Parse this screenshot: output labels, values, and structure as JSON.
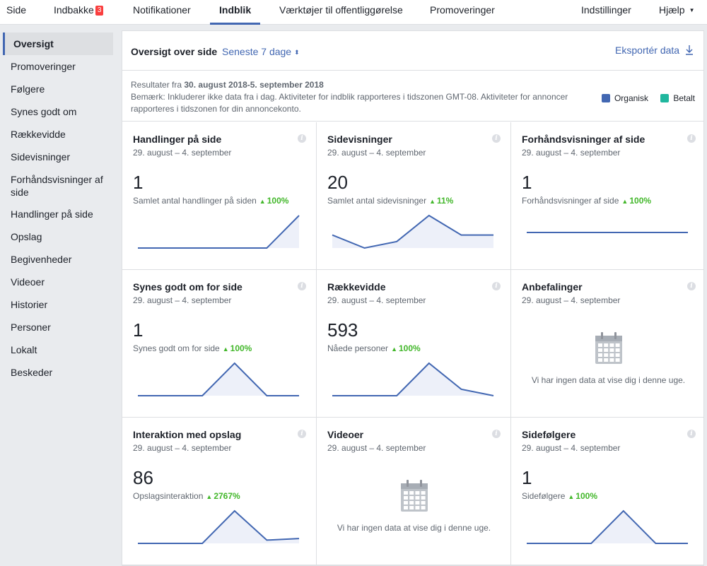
{
  "topnav": {
    "items": [
      {
        "label": "Side"
      },
      {
        "label": "Indbakke",
        "badge": "3"
      },
      {
        "label": "Notifikationer"
      },
      {
        "label": "Indblik"
      },
      {
        "label": "Værktøjer til offentliggørelse"
      },
      {
        "label": "Promoveringer"
      }
    ],
    "right": [
      {
        "label": "Indstillinger"
      },
      {
        "label": "Hjælp"
      }
    ]
  },
  "sidebar": {
    "items": [
      {
        "label": "Oversigt"
      },
      {
        "label": "Promoveringer"
      },
      {
        "label": "Følgere"
      },
      {
        "label": "Synes godt om"
      },
      {
        "label": "Rækkevidde"
      },
      {
        "label": "Sidevisninger"
      },
      {
        "label": "Forhåndsvisninger af side"
      },
      {
        "label": "Handlinger på side"
      },
      {
        "label": "Opslag"
      },
      {
        "label": "Begivenheder"
      },
      {
        "label": "Videoer"
      },
      {
        "label": "Historier"
      },
      {
        "label": "Personer"
      },
      {
        "label": "Lokalt"
      },
      {
        "label": "Beskeder"
      }
    ]
  },
  "header": {
    "title": "Oversigt over side",
    "period": "Seneste 7 dage",
    "export": "Eksportér data"
  },
  "subhead": {
    "results_prefix": "Resultater fra",
    "results_range": "30. august 2018-5. september 2018",
    "note": "Bemærk: Inkluderer ikke data fra i dag. Aktiviteter for indblik rapporteres i tidszonen GMT-08. Aktiviteter for annoncer rapporteres i tidszonen for din annoncekonto.",
    "legend": [
      {
        "label": "Organisk",
        "color": "#4267b2"
      },
      {
        "label": "Betalt",
        "color": "#20b79e"
      }
    ]
  },
  "colors": {
    "line": "#4267b2",
    "fill": "#edf0f9",
    "positive": "#42b72a"
  },
  "cards": [
    {
      "title": "Handlinger på side",
      "range": "29. august – 4. september",
      "value": "1",
      "metric": "Samlet antal handlinger på siden",
      "delta": "100%",
      "spark": [
        0,
        0,
        0,
        0,
        0,
        1
      ]
    },
    {
      "title": "Sidevisninger",
      "range": "29. august – 4. september",
      "value": "20",
      "metric": "Samlet antal sidevisninger",
      "delta": "11%",
      "spark": [
        2,
        0,
        1,
        5,
        2,
        2
      ]
    },
    {
      "title": "Forhåndsvisninger af side",
      "range": "29. august – 4. september",
      "value": "1",
      "metric": "Forhåndsvisninger af side",
      "delta": "100%",
      "spark": [
        1,
        1,
        1,
        1,
        1,
        1
      ]
    },
    {
      "title": "Synes godt om for side",
      "range": "29. august – 4. september",
      "value": "1",
      "metric": "Synes godt om for side",
      "delta": "100%",
      "spark": [
        0,
        0,
        0,
        1,
        0,
        0
      ]
    },
    {
      "title": "Rækkevidde",
      "range": "29. august – 4. september",
      "value": "593",
      "metric": "Nåede personer",
      "delta": "100%",
      "spark": [
        0,
        0,
        0,
        1,
        0.2,
        0
      ]
    },
    {
      "title": "Anbefalinger",
      "range": "29. august – 4. september",
      "nodata": "Vi har ingen data at vise dig i denne uge."
    },
    {
      "title": "Interaktion med opslag",
      "range": "29. august – 4. september",
      "value": "86",
      "metric": "Opslagsinteraktion",
      "delta": "2767%",
      "spark": [
        0,
        0,
        0,
        1,
        0.1,
        0.15
      ]
    },
    {
      "title": "Videoer",
      "range": "29. august – 4. september",
      "nodata": "Vi har ingen data at vise dig i denne uge."
    },
    {
      "title": "Sidefølgere",
      "range": "29. august – 4. september",
      "value": "1",
      "metric": "Sidefølgere",
      "delta": "100%",
      "spark": [
        0,
        0,
        0,
        1,
        0,
        0
      ]
    }
  ]
}
